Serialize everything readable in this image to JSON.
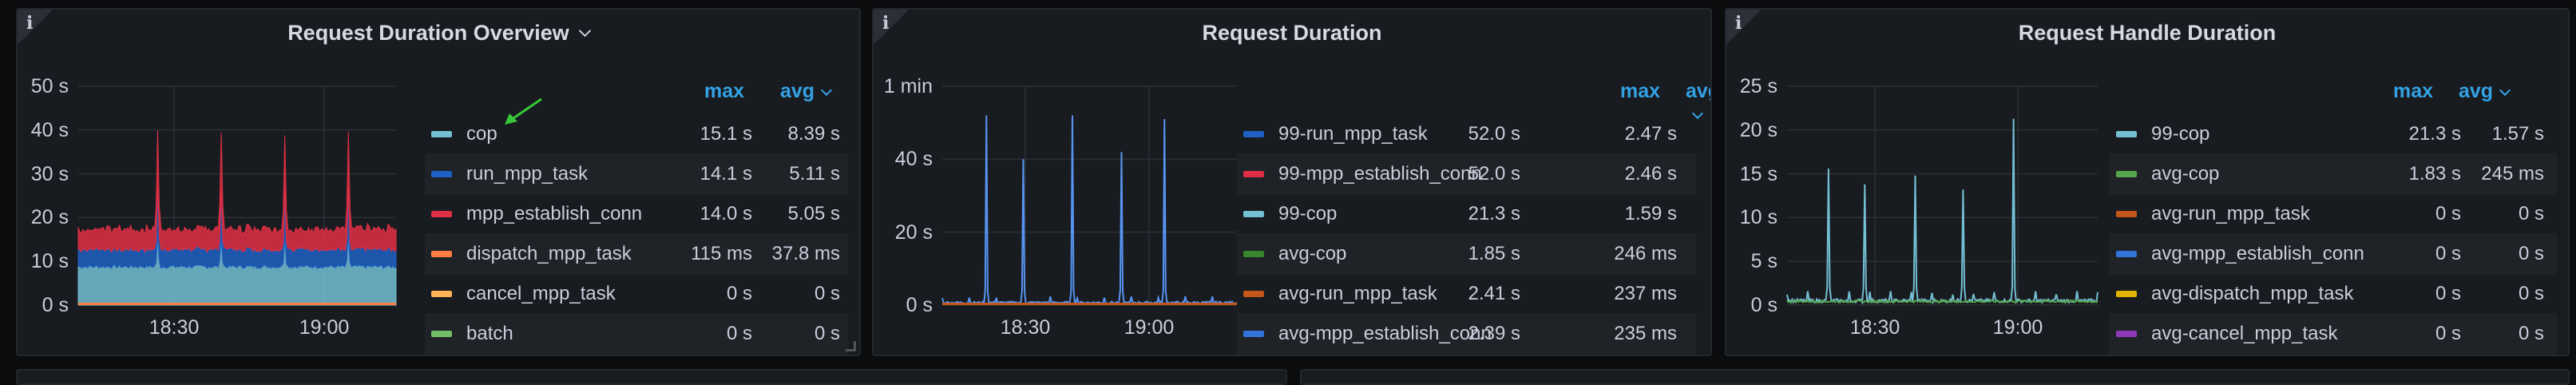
{
  "panels": [
    {
      "id": "p1",
      "title": "Request Duration Overview",
      "info_icon": "info-icon",
      "has_menu_chevron": true,
      "legend_headers": {
        "max": "max",
        "avg": "avg"
      },
      "legend": [
        {
          "name": "cop",
          "color": "#73bfd3",
          "max": "15.1 s",
          "avg": "8.39 s"
        },
        {
          "name": "run_mpp_task",
          "color": "#1f60c4",
          "max": "14.1 s",
          "avg": "5.11 s"
        },
        {
          "name": "mpp_establish_conn",
          "color": "#e02f44",
          "max": "14.0 s",
          "avg": "5.05 s"
        },
        {
          "name": "dispatch_mpp_task",
          "color": "#ff7f43",
          "max": "115 ms",
          "avg": "37.8 ms"
        },
        {
          "name": "cancel_mpp_task",
          "color": "#ffb357",
          "max": "0 s",
          "avg": "0 s"
        },
        {
          "name": "batch",
          "color": "#73bf69",
          "max": "0 s",
          "avg": "0 s"
        }
      ],
      "y_ticks": [
        "50 s",
        "40 s",
        "30 s",
        "20 s",
        "10 s",
        "0 s"
      ],
      "x_ticks": [
        "18:30",
        "19:00"
      ]
    },
    {
      "id": "p2",
      "title": "Request Duration",
      "info_icon": "info-icon",
      "has_menu_chevron": false,
      "legend_headers": {
        "max": "max",
        "avg": "avg"
      },
      "legend": [
        {
          "name": "99-run_mpp_task",
          "color": "#1f60c4",
          "max": "52.0 s",
          "avg": "2.47 s"
        },
        {
          "name": "99-mpp_establish_conn",
          "color": "#e02f44",
          "max": "52.0 s",
          "avg": "2.46 s"
        },
        {
          "name": "99-cop",
          "color": "#73bfd3",
          "max": "21.3 s",
          "avg": "1.59 s"
        },
        {
          "name": "avg-cop",
          "color": "#37872d",
          "max": "1.85 s",
          "avg": "246 ms"
        },
        {
          "name": "avg-run_mpp_task",
          "color": "#c4561a",
          "max": "2.41 s",
          "avg": "237 ms"
        },
        {
          "name": "avg-mpp_establish_conn",
          "color": "#3274d9",
          "max": "2.39 s",
          "avg": "235 ms"
        }
      ],
      "y_ticks": [
        "1 min",
        "40 s",
        "20 s",
        "0 s"
      ],
      "x_ticks": [
        "18:30",
        "19:00"
      ]
    },
    {
      "id": "p3",
      "title": "Request Handle Duration",
      "info_icon": "info-icon",
      "has_menu_chevron": false,
      "legend_headers": {
        "max": "max",
        "avg": "avg"
      },
      "legend": [
        {
          "name": "99-cop",
          "color": "#73bfd3",
          "max": "21.3 s",
          "avg": "1.57 s"
        },
        {
          "name": "avg-cop",
          "color": "#56a64b",
          "max": "1.83 s",
          "avg": "245 ms"
        },
        {
          "name": "avg-run_mpp_task",
          "color": "#c4561a",
          "max": "0 s",
          "avg": "0 s"
        },
        {
          "name": "avg-mpp_establish_conn",
          "color": "#3274d9",
          "max": "0 s",
          "avg": "0 s"
        },
        {
          "name": "avg-dispatch_mpp_task",
          "color": "#e0b400",
          "max": "0 s",
          "avg": "0 s"
        },
        {
          "name": "avg-cancel_mpp_task",
          "color": "#8f3bb8",
          "max": "0 s",
          "avg": "0 s"
        }
      ],
      "y_ticks": [
        "25 s",
        "20 s",
        "15 s",
        "10 s",
        "5 s",
        "0 s"
      ],
      "x_ticks": [
        "18:30",
        "19:00"
      ]
    }
  ]
}
